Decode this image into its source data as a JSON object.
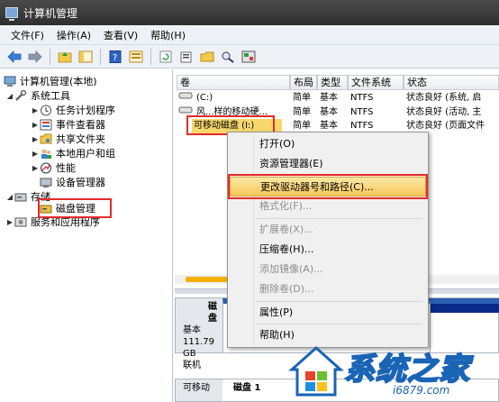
{
  "window": {
    "title": "计算机管理"
  },
  "menubar": {
    "items": [
      {
        "label": "文件(F)"
      },
      {
        "label": "操作(A)"
      },
      {
        "label": "查看(V)"
      },
      {
        "label": "帮助(H)"
      }
    ]
  },
  "toolbar": {
    "buttons": [
      {
        "icon": "back-arrow-icon"
      },
      {
        "icon": "forward-arrow-icon"
      },
      {
        "icon": "up-folder-icon"
      },
      {
        "icon": "show-hide-tree-icon"
      },
      {
        "icon": "help-icon"
      },
      {
        "icon": "properties-icon"
      },
      {
        "icon": "refresh-icon"
      },
      {
        "icon": "export-list-icon"
      },
      {
        "icon": "open-icon"
      },
      {
        "icon": "search-icon"
      },
      {
        "icon": "snap-in-icon"
      }
    ]
  },
  "tree": {
    "root": "计算机管理(本地)",
    "items": [
      {
        "label": "系统工具"
      },
      {
        "label": "任务计划程序"
      },
      {
        "label": "事件查看器"
      },
      {
        "label": "共享文件夹"
      },
      {
        "label": "本地用户和组"
      },
      {
        "label": "性能"
      },
      {
        "label": "设备管理器"
      },
      {
        "label": "存储"
      },
      {
        "label": "磁盘管理"
      },
      {
        "label": "服务和应用程序"
      }
    ]
  },
  "volume_table": {
    "columns": [
      "卷",
      "布局",
      "类型",
      "文件系统",
      "状态"
    ],
    "rows": [
      {
        "name": "(C:)",
        "layout": "简单",
        "type": "基本",
        "fs": "NTFS",
        "status": "状态良好 (系统, 启"
      },
      {
        "name": "风...样的移动硬...",
        "layout": "简单",
        "type": "基本",
        "fs": "NTFS",
        "status": "状态良好 (活动, 主"
      },
      {
        "name": "可移动磁盘 (I:)",
        "layout": "简单",
        "type": "基本",
        "fs": "NTFS",
        "status": "状态良好 (页面文件"
      }
    ]
  },
  "disks": [
    {
      "title": "磁盘",
      "type": "基本",
      "size": "111.79 GB",
      "state": "联机"
    },
    {
      "title": "磁盘 1",
      "type": "可移动"
    }
  ],
  "context_menu": {
    "items": [
      {
        "label": "打开(O)",
        "enabled": true
      },
      {
        "label": "资源管理器(E)",
        "enabled": true
      },
      {
        "label": "更改驱动器号和路径(C)...",
        "enabled": true,
        "highlighted": true
      },
      {
        "label": "格式化(F)...",
        "enabled": false
      },
      {
        "label": "扩展卷(X)...",
        "enabled": false
      },
      {
        "label": "压缩卷(H)...",
        "enabled": true
      },
      {
        "label": "添加镜像(A)...",
        "enabled": false
      },
      {
        "label": "删除卷(D)...",
        "enabled": false
      },
      {
        "label": "属性(P)",
        "enabled": true
      },
      {
        "label": "帮助(H)",
        "enabled": true
      }
    ]
  },
  "watermark": {
    "text": "系统之家",
    "url": "i6879.com"
  },
  "colors": {
    "highlight_red": "#e52a2a",
    "menu_highlight": "#f6c75a",
    "scroll_thumb": "#f2b000"
  }
}
